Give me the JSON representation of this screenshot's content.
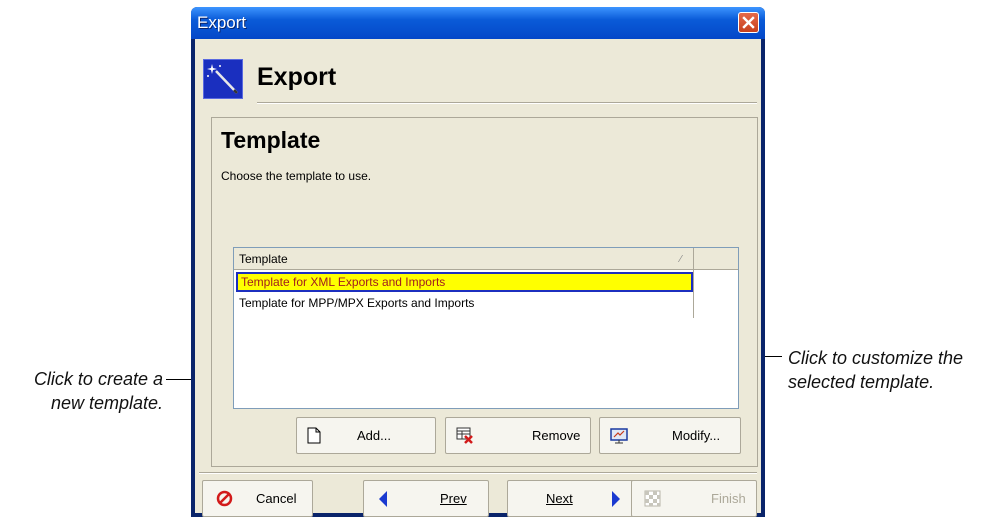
{
  "window": {
    "title": "Export"
  },
  "header": {
    "title": "Export",
    "icon": "wizard-wand-icon"
  },
  "step": {
    "title": "Template",
    "description": "Choose the template to use."
  },
  "template_list": {
    "column_header": "Template",
    "rows": [
      {
        "label": "Template for XML Exports and Imports",
        "selected": true
      },
      {
        "label": "Template for MPP/MPX Exports and Imports",
        "selected": false
      }
    ]
  },
  "list_buttons": {
    "add": "Add...",
    "remove": "Remove",
    "modify": "Modify..."
  },
  "nav_buttons": {
    "cancel": "Cancel",
    "prev": "Prev",
    "next": "Next",
    "finish": "Finish"
  },
  "annotations": {
    "left_line1": "Click to create a",
    "left_line2": "new template.",
    "right_line1": "Click to customize the",
    "right_line2": "selected template."
  },
  "colors": {
    "selection_bg": "#ffff00",
    "selection_border": "#1c2fbf",
    "titlebar": "#0a5bd8"
  }
}
